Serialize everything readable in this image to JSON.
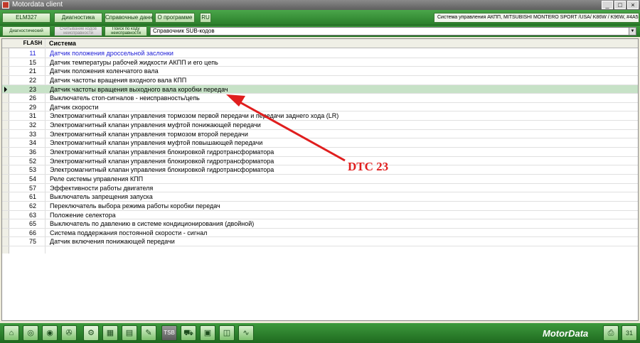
{
  "window": {
    "title": "Motordata client",
    "controls": [
      "_",
      "□",
      "×"
    ]
  },
  "toolbar": {
    "buttons": [
      "ELM327",
      "Диагностика",
      "Справочные данные",
      "О программе",
      "RU"
    ],
    "system_info": "Система управления АКПП, MITSUBISHI MONTERO SPORT /USA/ K86W / K96W,  #4A51 STD 1996-"
  },
  "subtoolbar": {
    "buttons": [
      "Диагностический разъём",
      "Считывание кодов неисправности",
      "Поиск по коду неисправности"
    ],
    "combo_value": "Справочник SUB-кодов"
  },
  "grid": {
    "columns": {
      "flash": "FLASH",
      "system": "Система"
    },
    "rows": [
      {
        "flash": "11",
        "system": "Датчик положения дроссельной заслонки"
      },
      {
        "flash": "15",
        "system": "Датчик температуры рабочей жидкости АКПП и его цепь"
      },
      {
        "flash": "21",
        "system": "Датчик положения коленчатого вала"
      },
      {
        "flash": "22",
        "system": "Датчик частоты вращения входного вала КПП"
      },
      {
        "flash": "23",
        "system": "Датчик частоты вращения выходного вала коробки передач"
      },
      {
        "flash": "26",
        "system": "Выключатель стоп-сигналов - неисправность/цепь"
      },
      {
        "flash": "29",
        "system": "Датчик скорости"
      },
      {
        "flash": "31",
        "system": "Электромагнитный клапан управления тормозом первой передачи и передачи заднего хода (LR)"
      },
      {
        "flash": "32",
        "system": "Электромагнитный клапан управления муфтой понижающей передачи"
      },
      {
        "flash": "33",
        "system": "Электромагнитный клапан управления тормозом второй передачи"
      },
      {
        "flash": "34",
        "system": "Электромагнитный клапан управления муфтой повышающей передачи"
      },
      {
        "flash": "36",
        "system": "Электромагнитный клапан управления блокировкой гидротрансформатора"
      },
      {
        "flash": "52",
        "system": "Электромагнитный клапан управления блокировкой гидротрансформатора"
      },
      {
        "flash": "53",
        "system": "Электромагнитный клапан управления блокировкой гидротрансформатора"
      },
      {
        "flash": "54",
        "system": "Реле системы управления КПП"
      },
      {
        "flash": "57",
        "system": "Эффективности работы двигателя"
      },
      {
        "flash": "61",
        "system": "Выключатель запрещения запуска"
      },
      {
        "flash": "62",
        "system": "Переключатель выбора режима работы коробки передач"
      },
      {
        "flash": "63",
        "system": "Положение селектора"
      },
      {
        "flash": "65",
        "system": "Выключатель по давлению в системе кондиционирования (двойной)"
      },
      {
        "flash": "66",
        "system": "Система поддержания постоянной скорости - сигнал"
      },
      {
        "flash": "75",
        "system": "Датчик включения понижающей передачи"
      }
    ]
  },
  "annotation": {
    "label": "DTC 23",
    "color": "#e01e1e"
  },
  "bottombar": {
    "icons": [
      "home-icon",
      "globe-icon",
      "disc-icon",
      "wheel-icon",
      "engine-icon",
      "chart-icon",
      "data-icon",
      "edit-icon",
      "tsb-icon",
      "car-icon",
      "print-icon",
      "dashboard-icon",
      "signal-icon"
    ],
    "tsb_label": "TSB",
    "brand": "MotorData",
    "right_icons": [
      "printer-icon",
      "calendar-icon"
    ],
    "calendar_label": "31"
  },
  "colors": {
    "accent_green": "#2a7d2a",
    "selected_row": "#c7e2c7",
    "link_blue": "#1a1ad6"
  }
}
